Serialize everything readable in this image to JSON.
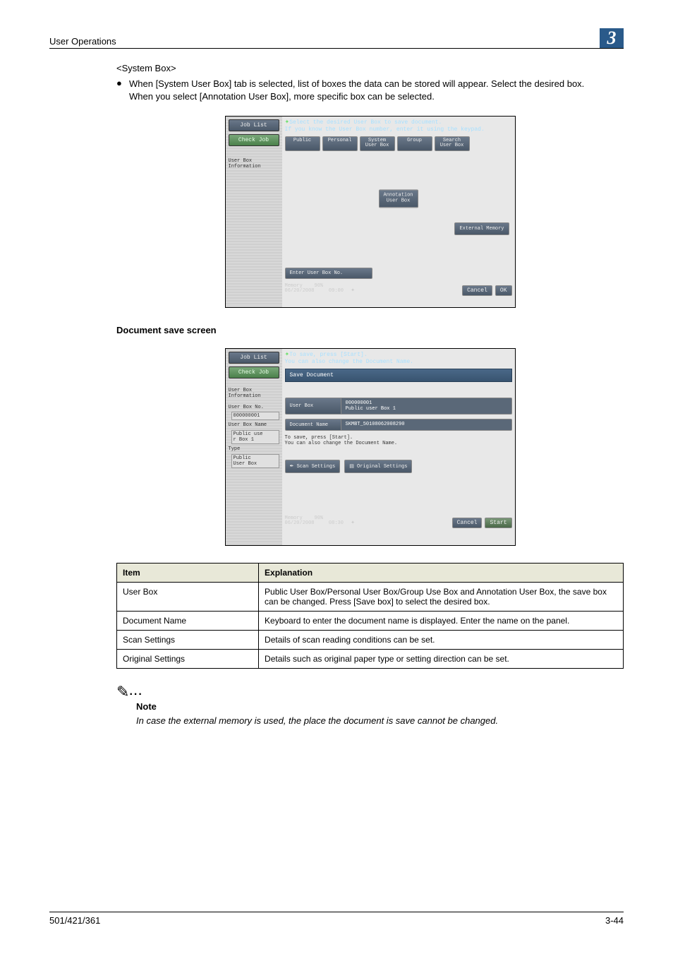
{
  "header": {
    "left": "User Operations",
    "chapter": "3"
  },
  "system_box_title": "<System Box>",
  "bullet1": "When [System User Box] tab is selected, list of boxes the data can be stored will appear. Select the desired box.",
  "bullet1_sub": "When you select [Annotation User Box], more specific box can be selected.",
  "ss1": {
    "job_list": "Job List",
    "check_job": "Check Job",
    "user_box_info": "User Box\nInformation",
    "hint1": "Select the desired User Box to save document.",
    "hint2": "If you know the User Box number, enter it using the keypad.",
    "tabs": [
      "Public",
      "Personal",
      "System\nUser Box",
      "Group",
      "Search\nUser Box"
    ],
    "mid_btn": "Annotation\nUser Box",
    "ext_mem": "External Memory",
    "enter_box": "Enter User Box No.",
    "date": "06/20/2008",
    "time": "09:00",
    "mem": "Memory",
    "mem_pct": "90%",
    "cancel": "Cancel",
    "ok": "OK"
  },
  "doc_save_heading": "Document save screen",
  "ss2": {
    "job_list": "Job List",
    "check_job": "Check Job",
    "user_box_info": "User Box\nInformation",
    "ub_no_lab": "User Box No.",
    "ub_no_val": "000000001",
    "ub_name_lab": "User Box Name",
    "ub_name_val": "Public use\nr Box 1",
    "type_lab": "Type",
    "type_val": "Public\nUser Box",
    "hint1": "To save, press [Start].",
    "hint2": "You can also change the Document Name.",
    "bar": "Save Document",
    "f1_lab": "User Box",
    "f1_val1": "000000001",
    "f1_val2": "Public user Box 1",
    "f2_lab": "Document Name",
    "f2_val": "SKMBT_50108062008290",
    "plain": "To save, press [Start].\nYou can also change the Document Name.",
    "scan": "Scan Settings",
    "orig": "Original Settings",
    "date": "06/20/2008",
    "time": "08:30",
    "mem": "Memory",
    "mem_pct": "90%",
    "cancel": "Cancel",
    "start": "Start"
  },
  "table": {
    "h1": "Item",
    "h2": "Explanation",
    "rows": [
      {
        "item": "User Box",
        "expl": "Public User Box/Personal User Box/Group Use Box and Annotation User Box, the save box can be changed. Press [Save box] to select the desired box."
      },
      {
        "item": "Document Name",
        "expl": "Keyboard to enter the document name is displayed. Enter the name on the panel."
      },
      {
        "item": "Scan Settings",
        "expl": "Details of scan reading conditions can be set."
      },
      {
        "item": "Original Settings",
        "expl": "Details such as original paper type or setting direction can be set."
      }
    ]
  },
  "note": {
    "label": "Note",
    "text": "In case the external memory is used, the place the document is save cannot be changed."
  },
  "footer": {
    "left": "501/421/361",
    "right": "3-44"
  }
}
